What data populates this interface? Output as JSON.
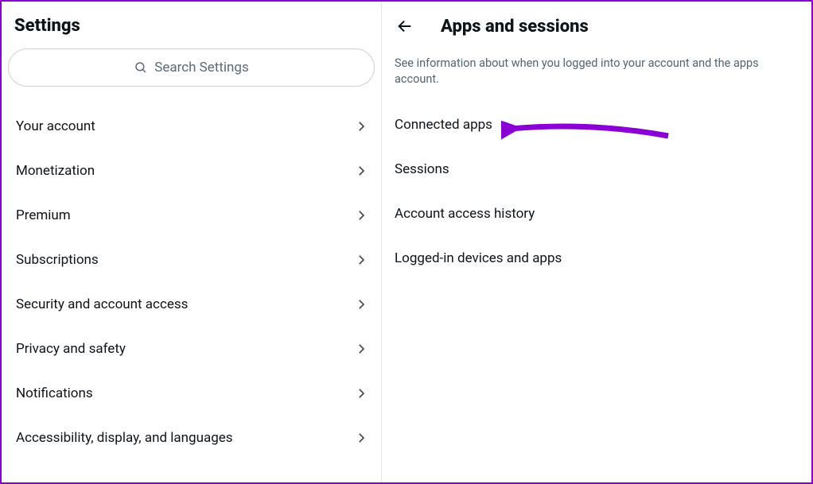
{
  "left": {
    "title": "Settings",
    "search_placeholder": "Search Settings",
    "menu": [
      {
        "label": "Your account"
      },
      {
        "label": "Monetization"
      },
      {
        "label": "Premium"
      },
      {
        "label": "Subscriptions"
      },
      {
        "label": "Security and account access"
      },
      {
        "label": "Privacy and safety"
      },
      {
        "label": "Notifications"
      },
      {
        "label": "Accessibility, display, and languages"
      }
    ]
  },
  "right": {
    "title": "Apps and sessions",
    "description": "See information about when you logged into your account and the apps account.",
    "items": [
      {
        "label": "Connected apps"
      },
      {
        "label": "Sessions"
      },
      {
        "label": "Account access history"
      },
      {
        "label": "Logged-in devices and apps"
      }
    ]
  },
  "annotation": {
    "arrow_color": "#8a00d4"
  }
}
